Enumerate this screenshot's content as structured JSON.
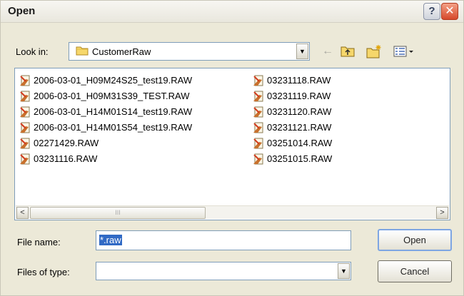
{
  "window": {
    "title": "Open",
    "help_label": "?",
    "close_label": "✕"
  },
  "look_in": {
    "label": "Look in:",
    "value": "CustomerRaw",
    "icon": "folder-icon"
  },
  "toolbar": {
    "back_icon": "←",
    "up_icon": "up-folder-icon",
    "new_folder_icon": "new-folder-icon",
    "view_menu_icon": "view-menu-icon"
  },
  "files": {
    "left": [
      "2006-03-01_H09M24S25_test19.RAW",
      "2006-03-01_H09M31S39_TEST.RAW",
      "2006-03-01_H14M01S14_test19.RAW",
      "2006-03-01_H14M01S54_test19.RAW",
      "02271429.RAW",
      "03231116.RAW"
    ],
    "right": [
      "03231118.RAW",
      "03231119.RAW",
      "03231120.RAW",
      "03231121.RAW",
      "03251014.RAW",
      "03251015.RAW"
    ]
  },
  "scrollbar": {
    "left_arrow": "<",
    "right_arrow": ">",
    "thumb_grip": "III"
  },
  "file_name": {
    "label": "File name:",
    "value": "*.raw"
  },
  "file_type": {
    "label": "Files of type:",
    "value": ""
  },
  "buttons": {
    "open": "Open",
    "cancel": "Cancel"
  },
  "colors": {
    "dialog_bg": "#ece9d8",
    "selection": "#316ac5",
    "close_red": "#d6492b"
  }
}
